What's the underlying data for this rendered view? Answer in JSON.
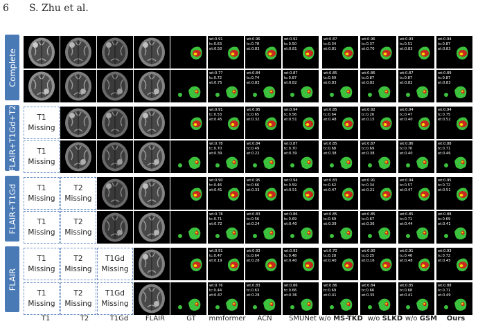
{
  "header": {
    "page_number": "6",
    "authors": "S. Zhu et al."
  },
  "groups": [
    {
      "label": "Complete"
    },
    {
      "label": "FLAIR+T1Gd+T2"
    },
    {
      "label": "FLAIR+T1Gd"
    },
    {
      "label": "FLAIR"
    }
  ],
  "missing": {
    "t1": [
      "T1",
      "Missing"
    ],
    "t2": [
      "T2",
      "Missing"
    ],
    "t1gd": [
      "T1Gd",
      "Missing"
    ]
  },
  "columns": {
    "t1": "T1",
    "t2": "T2",
    "t1gd": "T1Gd",
    "flair": "FLAIR",
    "gt": "GT",
    "mmformer": "mmformer",
    "acn": "ACN",
    "smunet": "SMUNet",
    "mstkd_prefix": "w/o",
    "mstkd": "MS-TKD",
    "slkd_prefix": "w/o",
    "slkd": "SLKD",
    "gsm_prefix": "w/o",
    "gsm": "GSM",
    "ours": "Ours"
  },
  "rows": [
    {
      "mmformer": [
        "wt:0.91",
        "tc:0.63",
        "et:0.50"
      ],
      "acn": [
        "wt:0.96",
        "tc:0.78",
        "et:0.83"
      ],
      "smunet": [
        "wt:0.92",
        "tc:0.50",
        "et:0.81"
      ],
      "mstkd": [
        "wt:0.87",
        "tc:0.34",
        "et:0.81"
      ],
      "slkd": [
        "wt:0.96",
        "tc:0.37",
        "et:0.70"
      ],
      "gsm": [
        "wt:0.93",
        "tc:0.51",
        "et:0.83"
      ],
      "ours": [
        "wt:0.94",
        "tc:0.87",
        "et:0.83"
      ]
    },
    {
      "mmformer": [
        "wt:0.77",
        "tc:0.72",
        "et:0.75"
      ],
      "acn": [
        "wt:0.84",
        "tc:0.74",
        "et:0.83"
      ],
      "smunet": [
        "wt:0.87",
        "tc:0.87",
        "et:0.82"
      ],
      "mstkd": [
        "wt:0.85",
        "tc:0.69",
        "et:0.83"
      ],
      "slkd": [
        "wt:0.86",
        "tc:0.87",
        "et:0.82"
      ],
      "gsm": [
        "wt:0.87",
        "tc:0.87",
        "et:0.82"
      ],
      "ours": [
        "wt:0.89",
        "tc:0.87",
        "et:0.83"
      ]
    },
    {
      "mmformer": [
        "wt:0.91",
        "tc:0.53",
        "et:0.45"
      ],
      "acn": [
        "wt:0.95",
        "tc:0.65",
        "et:0.32"
      ],
      "smunet": [
        "wt:0.94",
        "tc:0.56",
        "et:0.51"
      ],
      "mstkd": [
        "wt:0.85",
        "tc:0.64",
        "et:0.48"
      ],
      "slkd": [
        "wt:0.92",
        "tc:0.26",
        "et:0.15"
      ],
      "gsm": [
        "wt:0.94",
        "tc:0.47",
        "et:0.40"
      ],
      "ours": [
        "wt:0.94",
        "tc:0.75",
        "et:0.52"
      ]
    },
    {
      "mmformer": [
        "wt:0.78",
        "tc:0.70",
        "et:0.39"
      ],
      "acn": [
        "wt:0.84",
        "tc:0.49",
        "et:0.22"
      ],
      "smunet": [
        "wt:0.87",
        "tc:0.70",
        "et:0.39"
      ],
      "mstkd": [
        "wt:0.85",
        "tc:0.68",
        "et:0.38"
      ],
      "slkd": [
        "wt:0.87",
        "tc:0.69",
        "et:0.38"
      ],
      "gsm": [
        "wt:0.86",
        "tc:0.70",
        "et:0.40"
      ],
      "ours": [
        "wt:0.88",
        "tc:0.71",
        "et:0.46"
      ]
    },
    {
      "mmformer": [
        "wt:0.90",
        "tc:0.46",
        "et:0.41"
      ],
      "acn": [
        "wt:0.95",
        "tc:0.66",
        "et:0.33"
      ],
      "smunet": [
        "wt:0.94",
        "tc:0.59",
        "et:0.51"
      ],
      "mstkd": [
        "wt:0.83",
        "tc:0.62",
        "et:0.47"
      ],
      "slkd": [
        "wt:0.91",
        "tc:0.34",
        "et:0.21"
      ],
      "gsm": [
        "wt:0.94",
        "tc:0.57",
        "et:0.47"
      ],
      "ours": [
        "wt:0.95",
        "tc:0.72",
        "et:0.51"
      ]
    },
    {
      "mmformer": [
        "wt:0.78",
        "tc:0.71",
        "et:0.72"
      ],
      "acn": [
        "wt:0.83",
        "tc:0.56",
        "et:0.24"
      ],
      "smunet": [
        "wt:0.86",
        "tc:0.69",
        "et:0.40"
      ],
      "mstkd": [
        "wt:0.85",
        "tc:0.69",
        "et:0.39"
      ],
      "slkd": [
        "wt:0.85",
        "tc:0.67",
        "et:0.36"
      ],
      "gsm": [
        "wt:0.85",
        "tc:0.71",
        "et:0.44"
      ],
      "ours": [
        "wt:0.88",
        "tc:0.69",
        "et:0.41"
      ]
    },
    {
      "mmformer": [
        "wt:0.91",
        "tc:0.47",
        "et:0.19"
      ],
      "acn": [
        "wt:0.93",
        "tc:0.64",
        "et:0.28"
      ],
      "smunet": [
        "wt:0.93",
        "tc:0.48",
        "et:0.40"
      ],
      "mstkd": [
        "wt:0.70",
        "tc:0.28",
        "et:0.40"
      ],
      "slkd": [
        "wt:0.90",
        "tc:0.25",
        "et:0.16"
      ],
      "gsm": [
        "wt:0.91",
        "tc:0.46",
        "et:0.48"
      ],
      "ours": [
        "wt:0.93",
        "tc:0.72",
        "et:0.45"
      ]
    },
    {
      "mmformer": [
        "wt:0.76",
        "tc:0.44",
        "et:0.47"
      ],
      "acn": [
        "wt:0.83",
        "tc:0.63",
        "et:0.28"
      ],
      "smunet": [
        "wt:0.86",
        "tc:0.66",
        "et:0.36"
      ],
      "mstkd": [
        "wt:0.86",
        "tc:0.69",
        "et:0.41"
      ],
      "slkd": [
        "wt:0.84",
        "tc:0.66",
        "et:0.35"
      ],
      "gsm": [
        "wt:0.85",
        "tc:0.68",
        "et:0.41"
      ],
      "ours": [
        "wt:0.88",
        "tc:0.71",
        "et:0.49"
      ]
    }
  ]
}
